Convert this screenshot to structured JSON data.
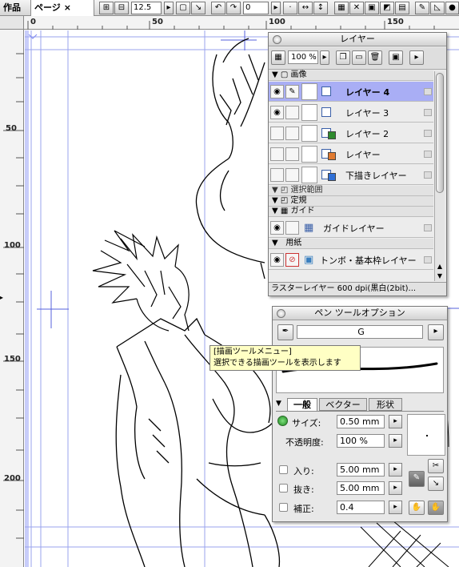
{
  "topbar": {
    "works_tab": "作品",
    "page_tab": "ページ",
    "page_tab_close": "×",
    "zoom_value": "12.5",
    "rotate_value": "0"
  },
  "rulers": {
    "h_labels": [
      "0",
      "50",
      "100",
      "150"
    ],
    "v_labels": [
      "50",
      "100",
      "150",
      "200"
    ]
  },
  "layer_panel": {
    "title": "レイヤー",
    "opacity": "100 %",
    "groups": {
      "image": "画像",
      "selection": "選択範囲",
      "ruler": "定規",
      "guide": "ガイド",
      "paper": "用紙"
    },
    "layers": [
      {
        "name": "レイヤー 4",
        "selected": true,
        "type_color": "#ffffff"
      },
      {
        "name": "レイヤー 3",
        "selected": false,
        "type_color": "#ffffff"
      },
      {
        "name": "レイヤー 2",
        "selected": false,
        "type_color": "#2e8b2e"
      },
      {
        "name": "レイヤー",
        "selected": false,
        "type_color": "#e07a30"
      },
      {
        "name": "下描きレイヤー",
        "selected": false,
        "type_color": "#2f6fd6"
      }
    ],
    "guide_layer": "ガイドレイヤー",
    "paper_layer": "トンボ・基本枠レイヤー",
    "status": "ラスターレイヤー 600 dpi(黒白(2bit)..."
  },
  "pen_panel": {
    "title": "ペン ツールオプション",
    "tool_name": "G",
    "tabs": [
      "一般",
      "ベクター",
      "形状"
    ],
    "size_label": "サイズ:",
    "size_value": "0.50 mm",
    "opacity_label": "不透明度:",
    "opacity_value": "100 %",
    "in_label": "入り:",
    "in_value": "5.00 mm",
    "out_label": "抜き:",
    "out_value": "5.00 mm",
    "correction_label": "補正:",
    "correction_value": "0.4"
  },
  "tooltip": {
    "line1": "[描画ツールメニュー]",
    "line2": "選択できる描画ツールを表示します"
  },
  "colors": {
    "selected_layer": "#a9aef5",
    "guide_blue": "#4455dd",
    "size_indicator": "#2e9e2e"
  }
}
